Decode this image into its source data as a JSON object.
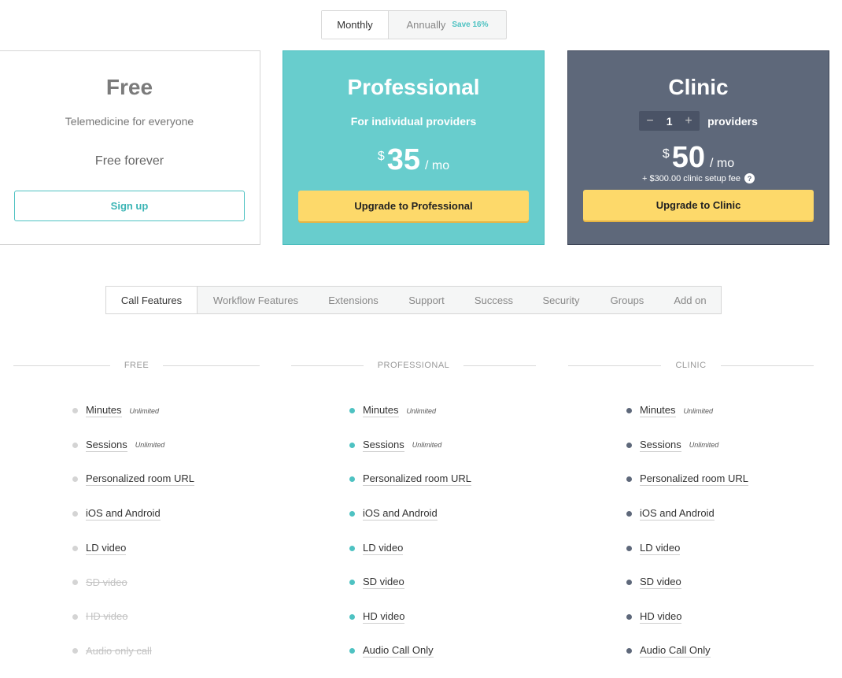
{
  "billing": {
    "monthly": "Monthly",
    "annually": "Annually",
    "save": "Save 16%"
  },
  "plans": {
    "free": {
      "name": "Free",
      "subtitle": "Telemedicine for everyone",
      "price_text": "Free forever",
      "cta": "Sign up"
    },
    "professional": {
      "name": "Professional",
      "subtitle": "For individual providers",
      "currency": "$",
      "amount": "35",
      "period": "/ mo",
      "cta": "Upgrade to Professional"
    },
    "clinic": {
      "name": "Clinic",
      "stepper_minus": "−",
      "stepper_value": "1",
      "stepper_plus": "+",
      "providers_label": "providers",
      "currency": "$",
      "amount": "50",
      "period": "/ mo",
      "setup_fee": "+ $300.00 clinic setup fee",
      "help_icon": "?",
      "cta": "Upgrade to Clinic"
    }
  },
  "feature_tabs": [
    "Call Features",
    "Workflow Features",
    "Extensions",
    "Support",
    "Success",
    "Security",
    "Groups",
    "Add on"
  ],
  "columns": {
    "free": "FREE",
    "professional": "PROFESSIONAL",
    "clinic": "CLINIC"
  },
  "colors": {
    "teal": "#68cdcd",
    "slate": "#5e687a",
    "yellow": "#fdd96a",
    "free_bullet": "#d4d4d4",
    "pro_bullet": "#4ec2c2",
    "clinic_bullet": "#5e687a"
  },
  "features": {
    "free": [
      {
        "label": "Minutes",
        "badge": "Unlimited",
        "disabled": false
      },
      {
        "label": "Sessions",
        "badge": "Unlimited",
        "disabled": false
      },
      {
        "label": "Personalized room URL",
        "badge": "",
        "disabled": false
      },
      {
        "label": "iOS and Android",
        "badge": "",
        "disabled": false
      },
      {
        "label": "LD video",
        "badge": "",
        "disabled": false
      },
      {
        "label": "SD video",
        "badge": "",
        "disabled": true
      },
      {
        "label": "HD video",
        "badge": "",
        "disabled": true
      },
      {
        "label": "Audio only call",
        "badge": "",
        "disabled": true
      }
    ],
    "professional": [
      {
        "label": "Minutes",
        "badge": "Unlimited",
        "disabled": false
      },
      {
        "label": "Sessions",
        "badge": "Unlimited",
        "disabled": false
      },
      {
        "label": "Personalized room URL",
        "badge": "",
        "disabled": false
      },
      {
        "label": "iOS and Android",
        "badge": "",
        "disabled": false
      },
      {
        "label": "LD video",
        "badge": "",
        "disabled": false
      },
      {
        "label": "SD video",
        "badge": "",
        "disabled": false
      },
      {
        "label": "HD video",
        "badge": "",
        "disabled": false
      },
      {
        "label": "Audio Call Only",
        "badge": "",
        "disabled": false
      }
    ],
    "clinic": [
      {
        "label": "Minutes",
        "badge": "Unlimited",
        "disabled": false
      },
      {
        "label": "Sessions",
        "badge": "Unlimited",
        "disabled": false
      },
      {
        "label": "Personalized room URL",
        "badge": "",
        "disabled": false
      },
      {
        "label": "iOS and Android",
        "badge": "",
        "disabled": false
      },
      {
        "label": "LD video",
        "badge": "",
        "disabled": false
      },
      {
        "label": "SD video",
        "badge": "",
        "disabled": false
      },
      {
        "label": "HD video",
        "badge": "",
        "disabled": false
      },
      {
        "label": "Audio Call Only",
        "badge": "",
        "disabled": false
      }
    ]
  }
}
